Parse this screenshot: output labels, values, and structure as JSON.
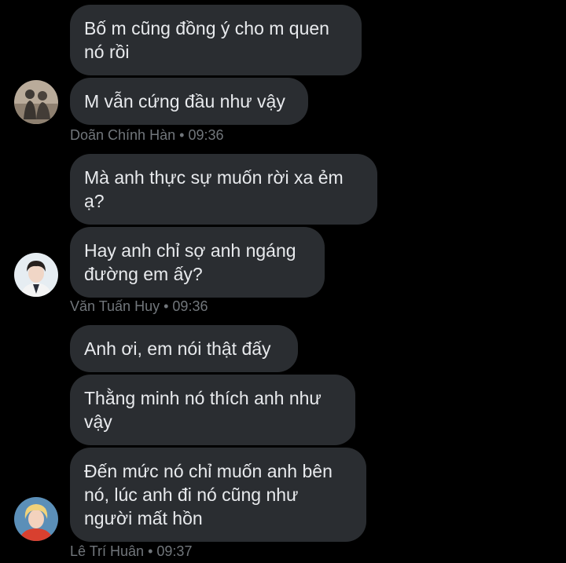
{
  "groups": [
    {
      "sender": "Doãn Chính Hàn",
      "time": "09:36",
      "avatar_icon": "profile-photo-figures",
      "messages": [
        "Bố m cũng đồng ý cho m quen\nnó rồi",
        "M vẫn cứng đầu như vậy"
      ]
    },
    {
      "sender": "Văn Tuấn Huy",
      "time": "09:36",
      "avatar_icon": "profile-photo-person",
      "messages": [
        "Mà anh thực sự muốn rời xa ẻm\nạ?",
        "Hay anh chỉ sợ anh ngáng\nđường em ấy?"
      ]
    },
    {
      "sender": "Lê Trí Huân",
      "time": "09:37",
      "avatar_icon": "profile-photo-blond",
      "messages": [
        "Anh ơi, em nói thật đấy",
        "Thằng minh nó thích anh như\nvậy",
        "Đến mức nó chỉ muốn anh bên\nnó, lúc anh đi nó cũng như\nngười mất hồn"
      ]
    }
  ],
  "separator": "•",
  "colors": {
    "background": "#000000",
    "bubble": "#2a2d31",
    "text": "#e8eaed",
    "meta": "#71767b"
  }
}
